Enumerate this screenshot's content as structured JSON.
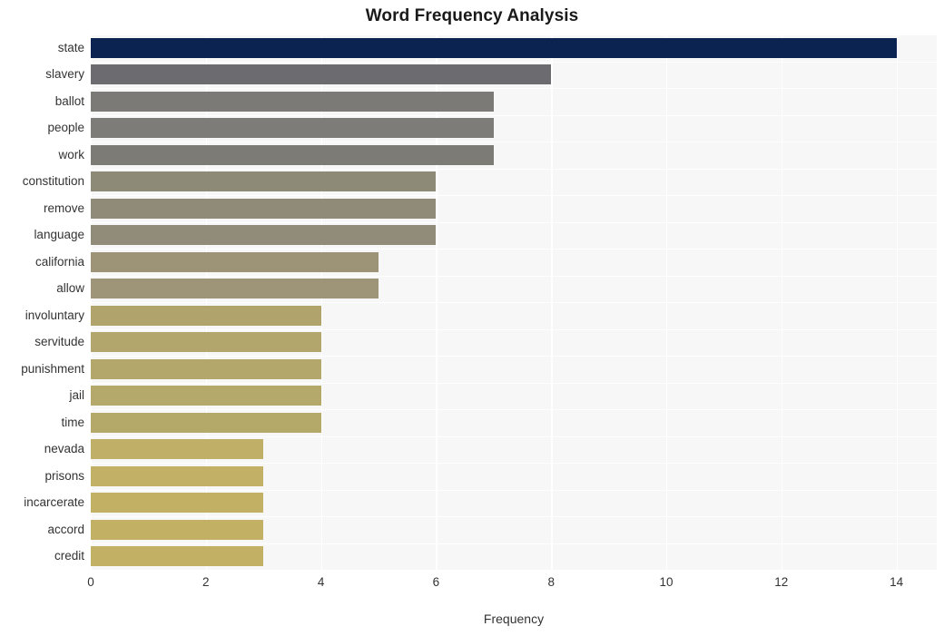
{
  "chart_data": {
    "type": "bar",
    "orientation": "horizontal",
    "title": "Word Frequency Analysis",
    "xlabel": "Frequency",
    "ylabel": "",
    "categories": [
      "state",
      "slavery",
      "ballot",
      "people",
      "work",
      "constitution",
      "remove",
      "language",
      "california",
      "allow",
      "involuntary",
      "servitude",
      "punishment",
      "jail",
      "time",
      "nevada",
      "prisons",
      "incarcerate",
      "accord",
      "credit"
    ],
    "values": [
      14,
      8,
      7,
      7,
      7,
      6,
      6,
      6,
      5,
      5,
      4,
      4,
      4,
      4,
      4,
      3,
      3,
      3,
      3,
      3
    ],
    "xlim": [
      0,
      14.7
    ],
    "xticks": [
      0,
      2,
      4,
      6,
      8,
      10,
      12,
      14
    ],
    "xticklabels": [
      "0",
      "2",
      "4",
      "6",
      "8",
      "10",
      "12",
      "14"
    ],
    "grid": true,
    "grid_color": "#ffffff",
    "plot_background": "#f7f7f7",
    "legend": null,
    "bar_colors": [
      "#0a2351",
      "#6b6b70",
      "#7b7a77",
      "#7d7c78",
      "#7d7b76",
      "#8e8a78",
      "#8f8b78",
      "#908c79",
      "#9d9478",
      "#9e9578",
      "#b0a46c",
      "#b2a66c",
      "#b3a76b",
      "#b4a86b",
      "#b5a96a",
      "#c0af66",
      "#c1b066",
      "#c2b165",
      "#c2b165",
      "#c2b165"
    ]
  }
}
